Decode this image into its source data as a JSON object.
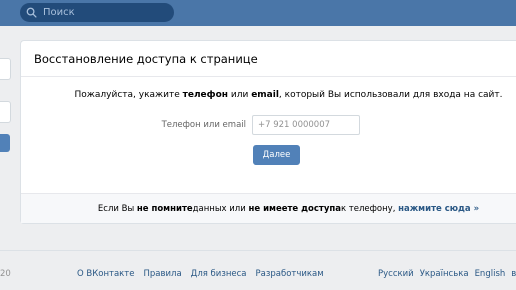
{
  "search": {
    "placeholder": "Поиск"
  },
  "card": {
    "title": "Восстановление доступа к странице",
    "instruction": {
      "before": "Пожалуйста, укажите ",
      "bold1": "телефон",
      "mid": " или ",
      "bold2": "email",
      "after": ", который Вы использовали для входа на сайт."
    },
    "field_label": "Телефон или email",
    "field_placeholder": "+7 921 0000007",
    "submit_label": "Далее",
    "footer": {
      "t1": "Если Вы ",
      "b1": "не помните",
      "t2": " данных или ",
      "b2": "не имеете доступа",
      "t3": " к телефону, ",
      "link": "нажмите сюда »"
    }
  },
  "footer": {
    "copyright": "20",
    "links": [
      "О ВКонтакте",
      "Правила",
      "Для бизнеса",
      "Разработчикам"
    ],
    "languages": [
      "Русский",
      "Українська",
      "English",
      "вс"
    ]
  },
  "colors": {
    "header_bg": "#4a76a8",
    "search_bg": "#224b7a",
    "button_bg": "#5181b8",
    "link": "#2a5885",
    "page_bg": "#edeef0"
  }
}
